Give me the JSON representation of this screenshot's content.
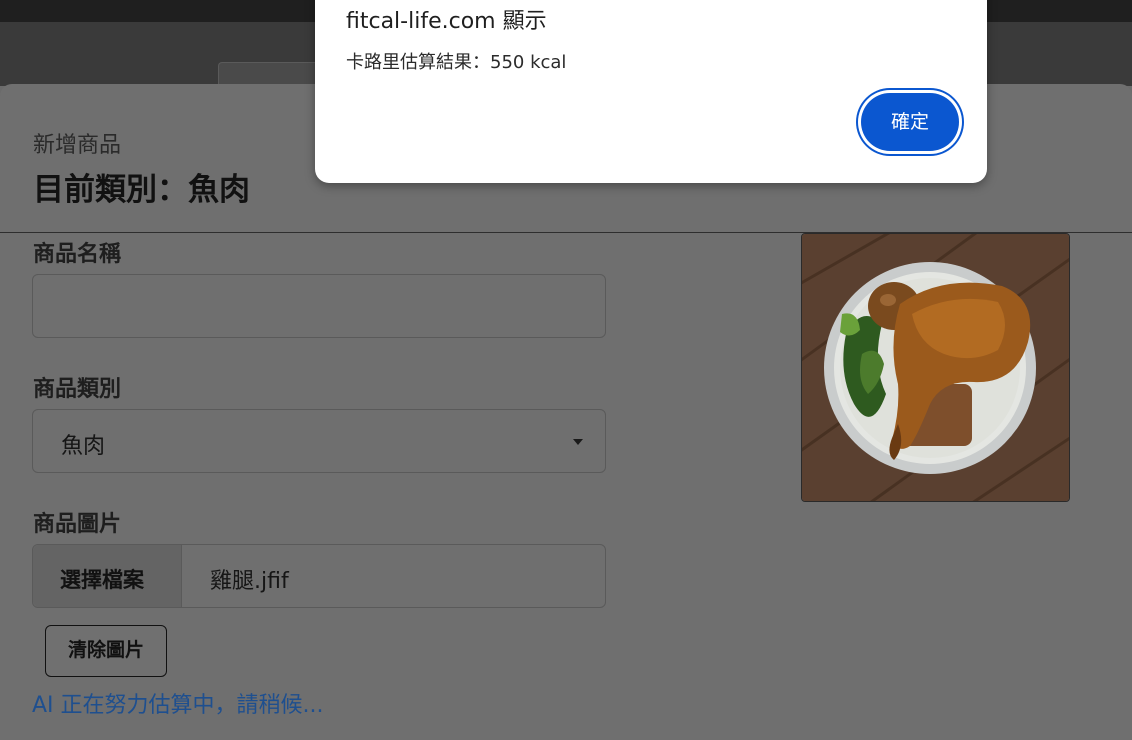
{
  "browser": {
    "site": "fitcal-life.com"
  },
  "dialog": {
    "title": "fitcal-life.com 顯示",
    "message": "卡路里估算結果：550 kcal",
    "ok_label": "確定",
    "accent_color": "#0b57d0"
  },
  "modal": {
    "subtitle": "新增商品",
    "title": "目前類別：魚肉",
    "fields": {
      "name_label": "商品名稱",
      "name_value": "",
      "category_label": "商品類別",
      "category_value": "魚肉",
      "image_label": "商品圖片",
      "choose_file_label": "選擇檔案",
      "file_name": "雞腿.jfif"
    },
    "clear_image_label": "清除圖片",
    "ai_status": "AI 正在努力估算中，請稍候...",
    "ai_status_color": "#1e4f8f",
    "preview_image": "chicken-leg-bento-bowl"
  }
}
